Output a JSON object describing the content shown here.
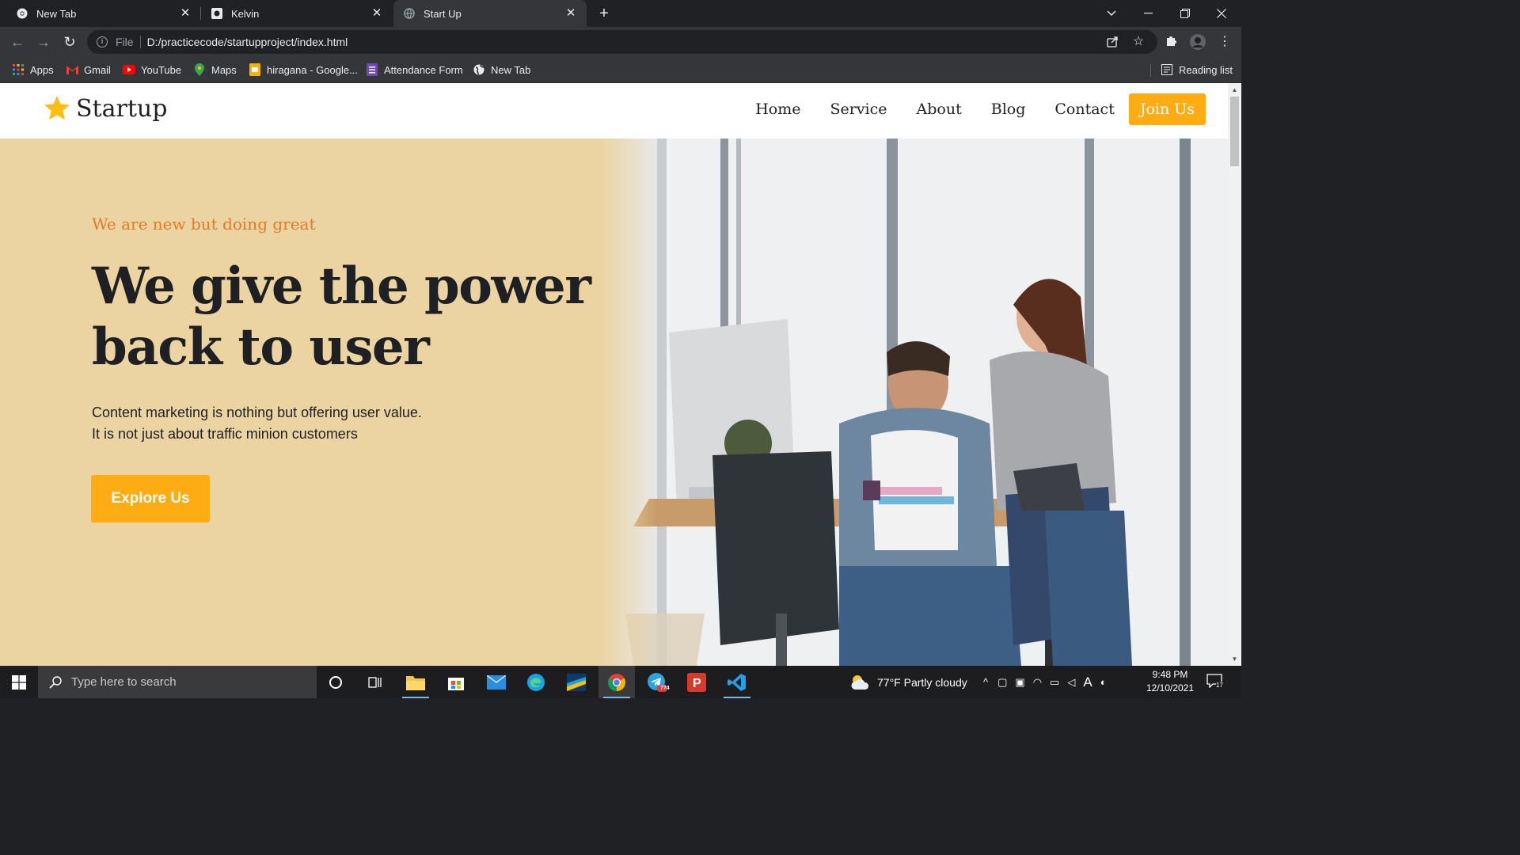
{
  "browser": {
    "tabs": [
      {
        "title": "New Tab",
        "icon": "chrome-icon",
        "active": false
      },
      {
        "title": "Kelvin",
        "icon": "kelvin-favicon",
        "active": false
      },
      {
        "title": "Start Up",
        "icon": "globe-icon",
        "active": true
      }
    ],
    "address": {
      "scheme": "File",
      "url": "D:/practicecode/startupproject/index.html"
    },
    "bookmarks": [
      {
        "label": "Apps",
        "icon": "apps-grid-icon"
      },
      {
        "label": "Gmail",
        "icon": "gmail-icon"
      },
      {
        "label": "YouTube",
        "icon": "youtube-icon"
      },
      {
        "label": "Maps",
        "icon": "maps-icon"
      },
      {
        "label": "hiragana - Google...",
        "icon": "slides-icon"
      },
      {
        "label": "Attendance Form",
        "icon": "forms-icon"
      },
      {
        "label": "New Tab",
        "icon": "globe-icon"
      }
    ],
    "reading_list": "Reading list"
  },
  "site": {
    "logo": "Startup",
    "nav": [
      "Home",
      "Service",
      "About",
      "Blog",
      "Contact"
    ],
    "cta": "Join Us",
    "accent": "#fdac14",
    "hero": {
      "tagline": "We are new but doing great",
      "headline_line1": "We give the power",
      "headline_line2": "back to user",
      "sub_line1": "Content marketing is nothing but offering user value.",
      "sub_line2": "It is not just about traffic minion customers",
      "button": "Explore Us",
      "background": "#ecd4a2"
    }
  },
  "taskbar": {
    "search_placeholder": "Type here to search",
    "weather": "77°F  Partly cloudy",
    "time": "9:48 PM",
    "date": "12/10/2021",
    "notifications": "17",
    "telegram_badge": "774"
  }
}
